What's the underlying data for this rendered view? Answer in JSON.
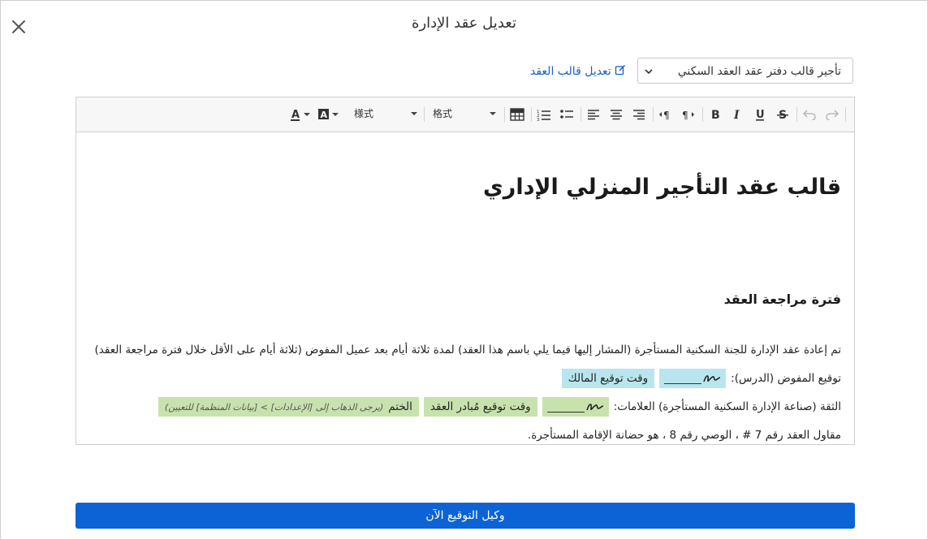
{
  "dialog": {
    "title": "تعديل عقد الإدارة"
  },
  "template_select": {
    "value": "تأجير قالب دفتر عقد العقد السكني"
  },
  "edit_template_link": {
    "label": "تعديل قالب العقد"
  },
  "toolbar": {
    "format_dropdown": "格式",
    "style_dropdown": "様式"
  },
  "document": {
    "title": "قالب عقد التأجير المنزلي الإداري",
    "section_heading": "فترة مراجعة العقد",
    "paragraph_1": "تم إعادة عقد الإدارة للجنة السكنية المستأجرة (المشار إليها فيما يلي باسم هذا العقد) لمدة ثلاثة أيام بعد عميل المفوض (ثلاثة أيام على الأقل خلال فترة مراجعة العقد)",
    "paragraph_2_label": "توقيع المفوض (الدرس):",
    "owner_sign_time": "وقت توقيع المالك",
    "paragraph_3_label": "الثقة (صناعة الإدارة السكنية المستأجرة) العلامات:",
    "initiator_sign_time": "وقت توقيع مُبادر العقد",
    "seal_label": "الختم",
    "seal_hint": "(يرجى الذهاب إلى [الإعدادات] > [بيانات المنظمة] للتعيين)",
    "paragraph_4": "مقاول العقد رقم 7 # ، الوصي رقم 8 ، هو حضانة الإقامة المستأجرة."
  },
  "footer": {
    "primary_button": "وكيل التوقيع الآن"
  },
  "colors": {
    "primary": "#0b63d6",
    "link": "#1560c8",
    "signature_field": "#b9e6ee",
    "seal_field": "#c8e2ad"
  }
}
